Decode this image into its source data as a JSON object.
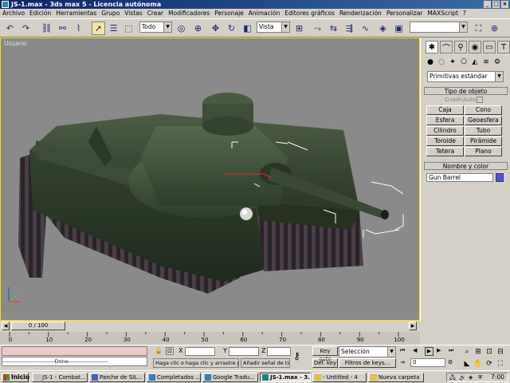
{
  "window": {
    "title": "JS-1.max - 3ds max 5 - Licencia autónoma"
  },
  "menu": [
    "Archivo",
    "Edición",
    "Herramientas",
    "Grupo",
    "Vistas",
    "Crear",
    "Modificadores",
    "Personaje",
    "Animación",
    "Editores gráficos",
    "Renderización",
    "Personalizar",
    "MAXScript",
    "?"
  ],
  "toolbar": {
    "selection_filter": "Todo",
    "reference_coord": "Vista",
    "named_selection": ""
  },
  "viewport": {
    "label": "Usuario"
  },
  "command_panel": {
    "category_dropdown": "Primitivas estándar",
    "object_type_title": "Tipo de objeto",
    "autogrid_label": "CuadriAuto",
    "buttons": [
      "Caja",
      "Cono",
      "Esfera",
      "Geoesfera",
      "Cilindro",
      "Tubo",
      "Toroide",
      "Pirámide",
      "Tetera",
      "Plano"
    ],
    "name_color_title": "Nombre y color",
    "object_name": "Gun Barrel",
    "object_color": "#5050e0"
  },
  "timeline": {
    "frame_display": "0 / 100",
    "ticks": [
      "0",
      "10",
      "20",
      "30",
      "40",
      "50",
      "60",
      "70",
      "80",
      "90",
      "100"
    ]
  },
  "status": {
    "listener_text": "----------------------------Done---------------------",
    "prompt": "Haga clic o haga clic y arrastre par",
    "add_time_tag": "Añadir señal de tiem",
    "x_label": "X",
    "y_label": "Y",
    "z_label": "Z",
    "key_auto": "Key auto",
    "def_key": "Def. key",
    "selection_combo": "Selección",
    "key_filters": "Filtros de keys...",
    "current_frame": "0"
  },
  "taskbar": {
    "start": "Inicio",
    "tasks": [
      "JS-1 - Combat...",
      "Parche de SIL...",
      "Completados ...",
      "Google Tradu...",
      "JS-1.max - 3...",
      "- Untitled - 4",
      "Nueva carpeta"
    ],
    "active_index": 4,
    "clock": "7:00"
  }
}
